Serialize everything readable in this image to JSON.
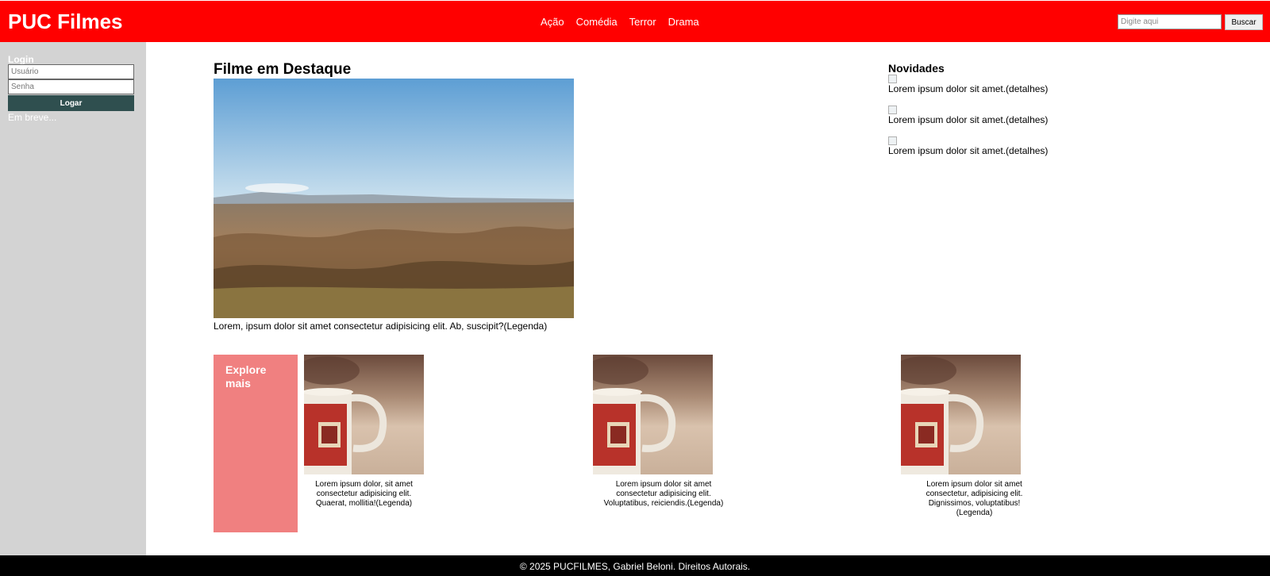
{
  "header": {
    "logo": "PUC Filmes",
    "nav": [
      "Ação",
      "Comédia",
      "Terror",
      "Drama"
    ],
    "search_placeholder": "Digite aqui",
    "search_button": "Buscar"
  },
  "sidebar": {
    "login_title": "Login",
    "user_placeholder": "Usuário",
    "password_placeholder": "Senha",
    "login_button": "Logar",
    "coming_soon": "Em breve..."
  },
  "featured": {
    "title": "Filme em Destaque",
    "caption": "Lorem, ipsum dolor sit amet consectetur adipisicing elit. Ab, suscipit?(Legenda)"
  },
  "news": {
    "title": "Novidades",
    "items": [
      "Lorem ipsum dolor sit amet.(detalhes)",
      "Lorem ipsum dolor sit amet.(detalhes)",
      "Lorem ipsum dolor sit amet.(detalhes)"
    ]
  },
  "explore": {
    "label": "Explore mais",
    "cards": [
      "Lorem ipsum dolor, sit amet consectetur adipisicing elit. Quaerat, mollitia!(Legenda)",
      "Lorem ipsum dolor sit amet consectetur adipisicing elit. Voluptatibus, reiciendis.(Legenda)",
      "Lorem ipsum dolor sit amet consectetur, adipisicing elit. Dignissimos, voluptatibus!(Legenda)"
    ]
  },
  "footer": {
    "text": "© 2025 PUCFILMES, Gabriel Beloni. Direitos Autorais."
  },
  "colors": {
    "header": "#ff0000",
    "sidebar": "#d3d3d3",
    "login_button": "#2f4f4f",
    "explore_box": "#f08080",
    "footer": "#000000"
  }
}
